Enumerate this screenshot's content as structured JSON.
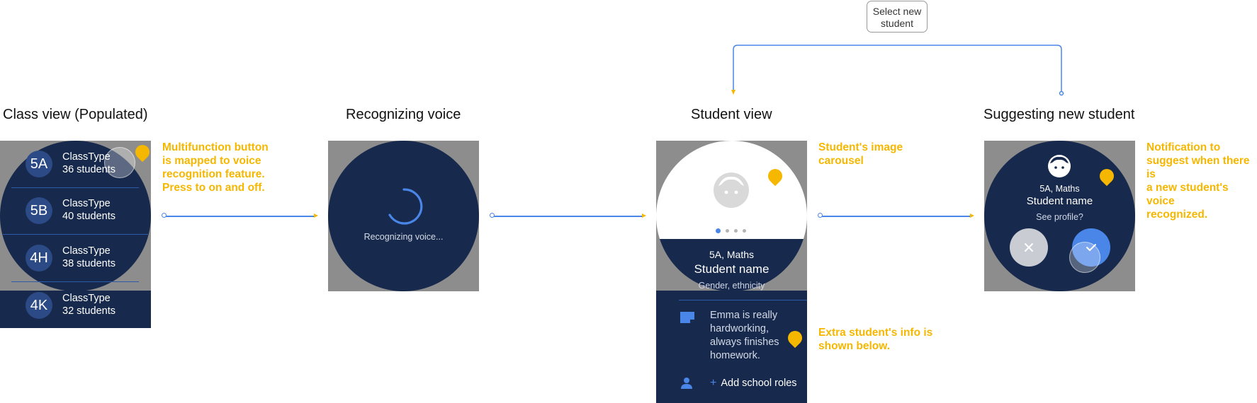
{
  "titles": {
    "class_view": "Class view (Populated)",
    "recognizing": "Recognizing voice",
    "student_view": "Student view",
    "suggesting": "Suggesting new student"
  },
  "select_box": {
    "line1": "Select new",
    "line2": "student"
  },
  "notes": {
    "multifunction": [
      "Multifunction button",
      "is mapped to voice",
      "recognition feature.",
      "Press to on and off."
    ],
    "image_carousel": [
      "Student's image",
      "carousel"
    ],
    "extra_info": [
      "Extra student's info is",
      "shown below."
    ],
    "notification": [
      "Notification to",
      "suggest when there is",
      "a new student's voice",
      "recognized."
    ]
  },
  "class_view": {
    "rows": [
      {
        "code": "5A",
        "type": "ClassType",
        "students": "36 students"
      },
      {
        "code": "5B",
        "type": "ClassType",
        "students": "40 students"
      },
      {
        "code": "4H",
        "type": "ClassType",
        "students": "38 students"
      },
      {
        "code": "4K",
        "type": "ClassType",
        "students": "32 students"
      }
    ]
  },
  "recognizing": {
    "label": "Recognizing voice..."
  },
  "student_view": {
    "class_subject": "5A, Maths",
    "name": "Student name",
    "details": "Gender, ethnicity",
    "note_lines": [
      "Emma is really",
      "hardworking,",
      "always finishes",
      "homework."
    ],
    "add_roles": "Add school roles",
    "plus": "+"
  },
  "suggesting": {
    "class_subject": "5A, Maths",
    "name": "Student name",
    "question": "See profile?"
  },
  "colors": {
    "navy": "#17294C",
    "accent_blue": "#4A86E8",
    "note_yellow": "#F5B700",
    "frame_gray": "#8d8d8d"
  },
  "icons": [
    "face-icon",
    "note-icon",
    "person-icon",
    "close-icon",
    "check-icon",
    "location-pin-icon",
    "loading-spinner-icon"
  ]
}
